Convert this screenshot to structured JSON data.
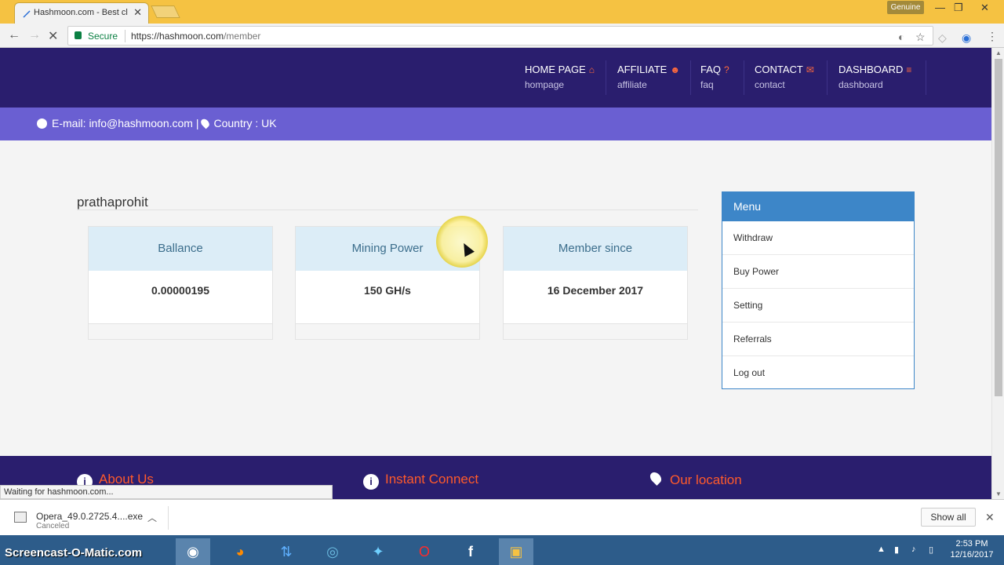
{
  "browser": {
    "tab_title": "Hashmoon.com - Best cl",
    "genuine_label": "Genuine",
    "secure_label": "Secure",
    "url_host": "https://hashmoon.com",
    "url_path": "/member",
    "status_text": "Waiting for hashmoon.com..."
  },
  "nav": {
    "items": [
      {
        "label": "HOME PAGE",
        "sub": "hompage",
        "icon": "home-icon"
      },
      {
        "label": "AFFILIATE",
        "sub": "affiliate",
        "icon": "users-icon"
      },
      {
        "label": "FAQ",
        "sub": "faq",
        "icon": "question-icon"
      },
      {
        "label": "CONTACT",
        "sub": "contact",
        "icon": "envelope-icon"
      },
      {
        "label": "DASHBOARD",
        "sub": "dashboard",
        "icon": "bars-icon"
      }
    ]
  },
  "info": {
    "email_text": "E-mail: info@hashmoon.com |",
    "country_text": "Country : UK"
  },
  "member": {
    "username": "prathaprohit",
    "cards": [
      {
        "title": "Ballance",
        "value": "0.00000195"
      },
      {
        "title": "Mining Power",
        "value": "150 GH/s"
      },
      {
        "title": "Member since",
        "value": "16 December 2017"
      }
    ]
  },
  "menu": {
    "title": "Menu",
    "items": [
      "Withdraw",
      "Buy Power",
      "Setting",
      "Referrals",
      "Log out"
    ]
  },
  "footer": {
    "about": "About Us",
    "connect": "Instant Connect",
    "location": "Our location"
  },
  "downloads": {
    "file_name": "Opera_49.0.2725.4....exe",
    "file_status": "Canceled",
    "show_all": "Show all"
  },
  "taskbar": {
    "watermark": "Screencast-O-Matic.com",
    "time": "2:53 PM",
    "date": "12/16/2017"
  },
  "colors": {
    "navbar": "#2a1e6e",
    "infobar": "#6a5fd2",
    "accent_orange": "#ff6a3d",
    "menu_blue": "#3d86c8"
  }
}
